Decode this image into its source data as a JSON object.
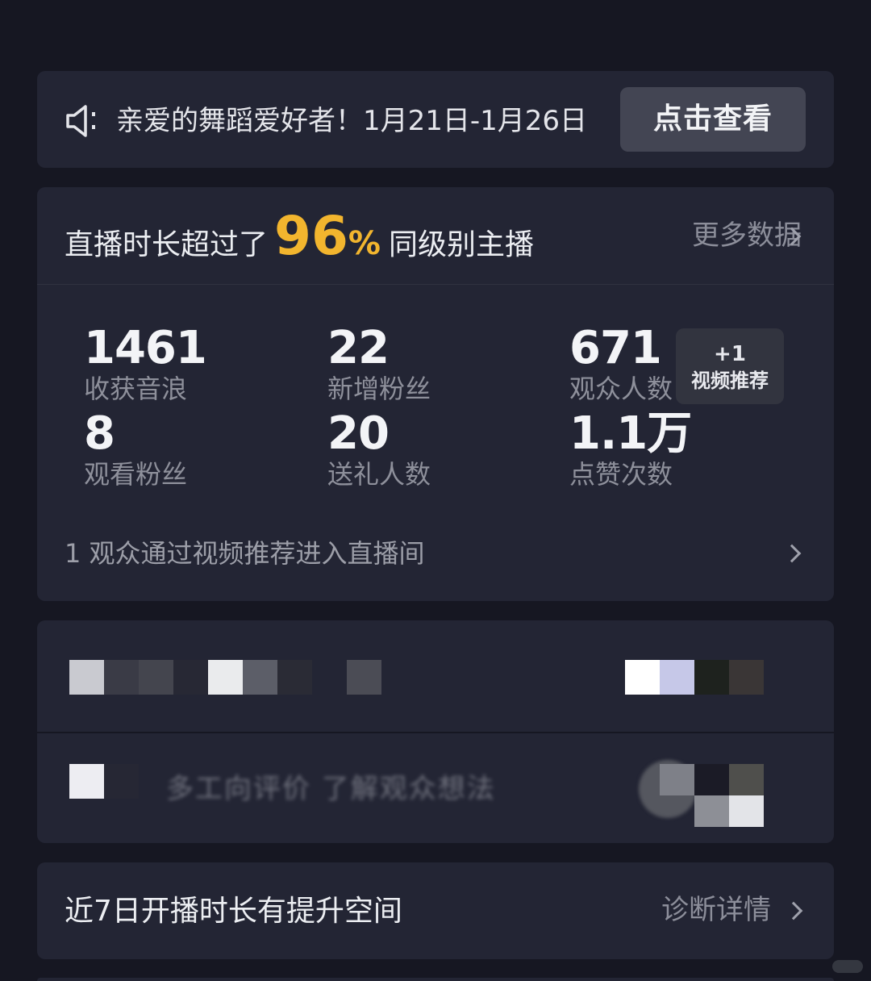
{
  "notice": {
    "text": "亲爱的舞蹈爱好者！1月21日-1月26日",
    "button_label": "点击查看",
    "icon": "speaker-icon"
  },
  "headline": {
    "prefix": "直播时长超过了",
    "percent_value": "96",
    "percent_sign": "%",
    "suffix": "同级别主播",
    "more_label": "更多数据"
  },
  "stats": [
    {
      "value": "1461",
      "label": "收获音浪"
    },
    {
      "value": "22",
      "label": "新增粉丝"
    },
    {
      "value": "671",
      "label": "观众人数"
    },
    {
      "value": "8",
      "label": "观看粉丝"
    },
    {
      "value": "20",
      "label": "送礼人数"
    },
    {
      "value": "1.1万",
      "label": "点赞次数"
    }
  ],
  "video_tag": {
    "line1": "+1",
    "line2": "视频推荐"
  },
  "video_line": "1 观众通过视频推荐进入直播间",
  "blurred_row": {
    "text": "多工向评价  了解观众想法"
  },
  "diagnosis": {
    "title": "近7日开播时长有提升空间",
    "link_label": "诊断详情"
  },
  "colors": {
    "background": "#161722",
    "card": "#232534",
    "accent": "#f2b52e",
    "button": "#434553"
  }
}
